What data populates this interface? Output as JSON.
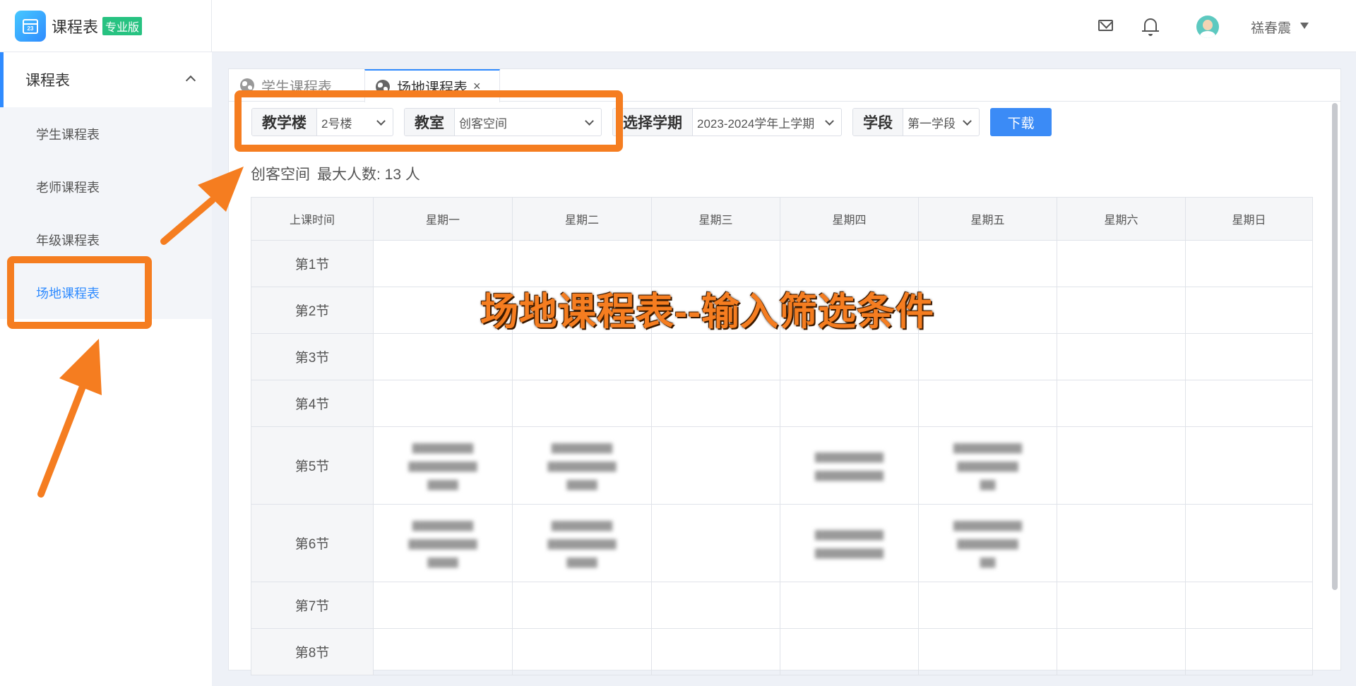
{
  "brand": {
    "name": "课程表",
    "edition_tag": "专业版",
    "logo_day": "23"
  },
  "header": {
    "user_name": "禚春震"
  },
  "sidebar": {
    "group_label": "课程表",
    "items": [
      {
        "label": "学生课程表"
      },
      {
        "label": "老师课程表"
      },
      {
        "label": "年级课程表"
      },
      {
        "label": "场地课程表"
      }
    ]
  },
  "tabs": [
    {
      "label": "学生课程表"
    },
    {
      "label": "场地课程表",
      "close": "×"
    }
  ],
  "filters": {
    "building": {
      "label": "教学楼",
      "value": "2号楼"
    },
    "room": {
      "label": "教室",
      "value": "创客空间"
    },
    "term": {
      "label": "选择学期",
      "value": "2023-2024学年上学期"
    },
    "stage": {
      "label": "学段",
      "value": "第一学段"
    },
    "download_label": "下载"
  },
  "room_info": {
    "name": "创客空间",
    "capacity_text": "最大人数: 13 人"
  },
  "timetable": {
    "headers": [
      "上课时间",
      "星期一",
      "星期二",
      "星期三",
      "星期四",
      "星期五",
      "星期六",
      "星期日"
    ],
    "periods": [
      "第1节",
      "第2节",
      "第3节",
      "第4节",
      "第5节",
      "第6节",
      "第7节",
      "第8节"
    ]
  },
  "annotation": {
    "callout": "场地课程表--输入筛选条件"
  },
  "colors": {
    "accent": "#2f8bff",
    "highlight": "#f57d20",
    "tag": "#27c281"
  }
}
